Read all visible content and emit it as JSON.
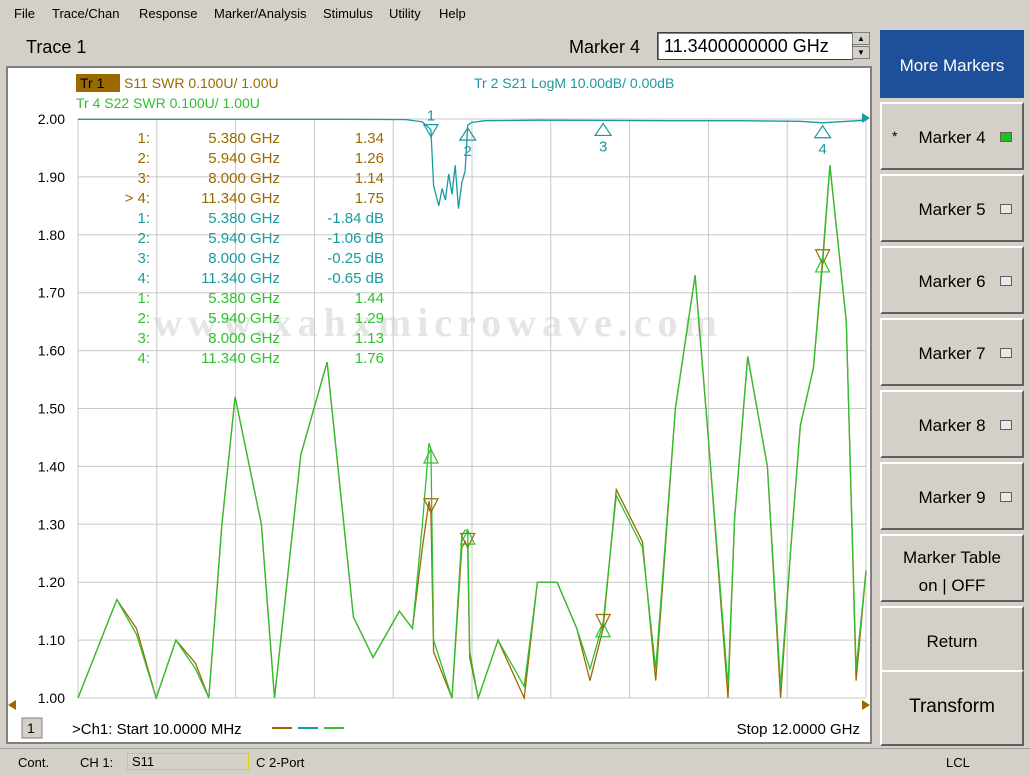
{
  "menu": [
    "File",
    "Trace/Chan",
    "Response",
    "Marker/Analysis",
    "Stimulus",
    "Utility",
    "Help"
  ],
  "header": {
    "trace_title": "Trace 1",
    "marker_label": "Marker 4",
    "marker_value": "11.3400000000 GHz"
  },
  "legend": {
    "tr1_tag": "Tr 1",
    "tr1": "S11 SWR 0.100U/ 1.00U",
    "tr2": "Tr 2 S21 LogM 10.00dB/ 0.00dB",
    "tr4": "Tr 4 S22 SWR 0.100U/ 1.00U"
  },
  "y_ticks": [
    "2.00",
    "1.90",
    "1.80",
    "1.70",
    "1.60",
    "1.50",
    "1.40",
    "1.30",
    "1.20",
    "1.10",
    "1.00"
  ],
  "marker_table": [
    {
      "trace": "Tr1",
      "n": "1:",
      "freq": "5.380 GHz",
      "val": "1.34"
    },
    {
      "trace": "Tr1",
      "n": "2:",
      "freq": "5.940 GHz",
      "val": "1.26"
    },
    {
      "trace": "Tr1",
      "n": "3:",
      "freq": "8.000 GHz",
      "val": "1.14"
    },
    {
      "trace": "Tr1",
      "n": "> 4:",
      "freq": "11.340 GHz",
      "val": "1.75"
    },
    {
      "trace": "Tr2",
      "n": "1:",
      "freq": "5.380 GHz",
      "val": "-1.84 dB"
    },
    {
      "trace": "Tr2",
      "n": "2:",
      "freq": "5.940 GHz",
      "val": "-1.06 dB"
    },
    {
      "trace": "Tr2",
      "n": "3:",
      "freq": "8.000 GHz",
      "val": "-0.25 dB"
    },
    {
      "trace": "Tr2",
      "n": "4:",
      "freq": "11.340 GHz",
      "val": "-0.65 dB"
    },
    {
      "trace": "Tr4",
      "n": "1:",
      "freq": "5.380 GHz",
      "val": "1.44"
    },
    {
      "trace": "Tr4",
      "n": "2:",
      "freq": "5.940 GHz",
      "val": "1.29"
    },
    {
      "trace": "Tr4",
      "n": "3:",
      "freq": "8.000 GHz",
      "val": "1.13"
    },
    {
      "trace": "Tr4",
      "n": "4:",
      "freq": "11.340 GHz",
      "val": "1.76"
    }
  ],
  "marker_flags": [
    "1",
    "2",
    "3",
    "4"
  ],
  "watermark": "www.xahxmicrowave.com",
  "channel_number": "1",
  "start_label": ">Ch1: Start 10.0000 MHz",
  "stop_label": "Stop 12.0000 GHz",
  "softkeys": {
    "more_markers": "More Markers",
    "marker4": "Marker 4",
    "marker5": "Marker 5",
    "marker6": "Marker 6",
    "marker7": "Marker 7",
    "marker8": "Marker 8",
    "marker9": "Marker 9",
    "marker_table_line1": "Marker Table",
    "marker_table_line2": "on | OFF",
    "return": "Return",
    "transform": "Transform",
    "star": "*"
  },
  "status": {
    "mode": "Cont.",
    "channel": "CH 1:",
    "param": "S11",
    "cal": "C 2-Port",
    "lcl": "LCL"
  },
  "colors": {
    "tr1": "#9a6a00",
    "tr2": "#1a9aa0",
    "tr4": "#30c030",
    "selected_softkey": "#1e4f9a"
  },
  "chart_data": {
    "type": "line",
    "x_unit": "GHz",
    "xlim": [
      0.01,
      12.0
    ],
    "ylim": [
      1.0,
      2.0
    ],
    "grid": true,
    "series": [
      {
        "name": "S11 SWR",
        "x": [
          0.01,
          0.6,
          0.9,
          1.2,
          1.5,
          1.8,
          2.0,
          2.2,
          2.4,
          2.8,
          3.0,
          3.4,
          3.8,
          4.2,
          4.5,
          4.9,
          5.1,
          5.25,
          5.35,
          5.38,
          5.42,
          5.7,
          5.85,
          5.9,
          5.94,
          5.97,
          6.1,
          6.4,
          6.8,
          7.0,
          7.3,
          7.6,
          7.8,
          8.0,
          8.2,
          8.6,
          8.8,
          9.1,
          9.4,
          9.6,
          9.9,
          10.0,
          10.2,
          10.5,
          10.7,
          10.85,
          11.0,
          11.2,
          11.34,
          11.45,
          11.7,
          11.85,
          12.0
        ],
        "y": [
          1.0,
          1.17,
          1.12,
          1.0,
          1.1,
          1.06,
          1.0,
          1.3,
          1.52,
          1.3,
          1.0,
          1.42,
          1.58,
          1.14,
          1.07,
          1.15,
          1.12,
          1.26,
          1.34,
          1.32,
          1.08,
          1.0,
          1.26,
          1.27,
          1.26,
          1.07,
          1.0,
          1.1,
          1.0,
          1.2,
          1.2,
          1.12,
          1.03,
          1.12,
          1.36,
          1.27,
          1.03,
          1.5,
          1.73,
          1.45,
          1.0,
          1.31,
          1.59,
          1.4,
          1.0,
          1.25,
          1.47,
          1.57,
          1.75,
          1.92,
          1.65,
          1.03,
          1.22
        ]
      },
      {
        "name": "S21 LogM",
        "x": [
          0.01,
          1.0,
          2.0,
          3.0,
          4.0,
          5.0,
          5.25,
          5.38,
          5.42,
          5.5,
          5.55,
          5.6,
          5.65,
          5.7,
          5.75,
          5.8,
          5.85,
          5.9,
          5.94,
          6.0,
          6.2,
          7.0,
          8.0,
          9.0,
          10.0,
          11.0,
          11.34,
          12.0
        ],
        "y": [
          -0.05,
          -0.05,
          -0.05,
          -0.05,
          -0.05,
          -0.1,
          -0.5,
          -1.84,
          -11.5,
          -15.0,
          -12.0,
          -14.0,
          -9.5,
          -13.0,
          -8.0,
          -15.5,
          -11.0,
          -9.0,
          -1.06,
          -0.6,
          -0.3,
          -0.2,
          -0.25,
          -0.3,
          -0.3,
          -0.4,
          -0.65,
          -0.2
        ]
      },
      {
        "name": "S22 SWR",
        "x": [
          0.01,
          0.6,
          0.9,
          1.2,
          1.5,
          1.8,
          2.0,
          2.2,
          2.4,
          2.8,
          3.0,
          3.4,
          3.8,
          4.2,
          4.5,
          4.9,
          5.1,
          5.25,
          5.35,
          5.38,
          5.42,
          5.7,
          5.85,
          5.9,
          5.94,
          5.97,
          6.1,
          6.4,
          6.8,
          7.0,
          7.3,
          7.6,
          7.8,
          8.0,
          8.2,
          8.6,
          8.8,
          9.1,
          9.4,
          9.6,
          9.9,
          10.0,
          10.2,
          10.5,
          10.7,
          10.85,
          11.0,
          11.2,
          11.34,
          11.45,
          11.7,
          11.85,
          12.0
        ],
        "y": [
          1.0,
          1.17,
          1.11,
          1.0,
          1.1,
          1.05,
          1.0,
          1.3,
          1.52,
          1.3,
          1.0,
          1.42,
          1.58,
          1.14,
          1.07,
          1.15,
          1.12,
          1.3,
          1.44,
          1.43,
          1.1,
          1.0,
          1.28,
          1.29,
          1.29,
          1.08,
          1.0,
          1.1,
          1.02,
          1.2,
          1.2,
          1.12,
          1.05,
          1.13,
          1.35,
          1.26,
          1.05,
          1.5,
          1.73,
          1.45,
          1.02,
          1.31,
          1.59,
          1.4,
          1.02,
          1.25,
          1.47,
          1.57,
          1.76,
          1.92,
          1.65,
          1.05,
          1.22
        ]
      }
    ],
    "markers": [
      {
        "id": "1",
        "x": 5.38
      },
      {
        "id": "2",
        "x": 5.94
      },
      {
        "id": "3",
        "x": 8.0
      },
      {
        "id": "4",
        "x": 11.34
      }
    ],
    "tr2_scale": {
      "ref_db": 0.0,
      "db_per_div": 10.0
    }
  }
}
